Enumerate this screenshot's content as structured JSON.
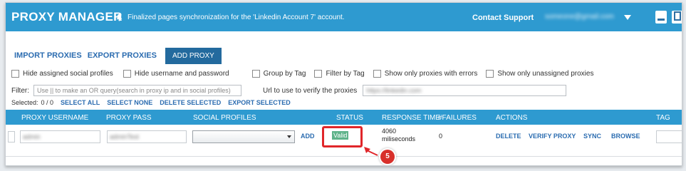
{
  "header": {
    "title": "PROXY MANAGER",
    "notification": "Finalized pages synchronization for the 'Linkedin Account 7' account.",
    "contact_support": "Contact Support",
    "user_email": "someone@gmail.com",
    "bell_icon": "bell-icon",
    "brand_color": "#2e9ad0"
  },
  "toolbar": {
    "import_label": "IMPORT PROXIES",
    "export_label": "EXPORT PROXIES",
    "add_label": "ADD PROXY"
  },
  "filters": {
    "options": [
      "Hide assigned social profiles",
      "Hide username and password",
      "Group by Tag",
      "Filter by Tag",
      "Show only proxies with errors",
      "Show only unassigned proxies"
    ],
    "filter_label": "Filter:",
    "filter_placeholder": "Use || to make an OR query(search in proxy ip and in social profiles)",
    "verify_url_label": "Url to use to verify the proxies",
    "verify_url_value": "https://linkedin.com"
  },
  "selection": {
    "selected_label": "Selected:",
    "selected_value": "0 / 0",
    "select_all": "SELECT ALL",
    "select_none": "SELECT NONE",
    "delete_selected": "DELETE SELECTED",
    "export_selected": "EXPORT SELECTED"
  },
  "table": {
    "headers": [
      "PROXY USERNAME",
      "PROXY PASS",
      "SOCIAL PROFILES",
      "STATUS",
      "RESPONSE TIME",
      "#FAILURES",
      "ACTIONS",
      "TAG"
    ],
    "row": {
      "username": "admin",
      "password": "adminTest",
      "add_label": "ADD",
      "status": "Valid",
      "response_time_value": "4060",
      "response_time_unit": "miliseconds",
      "failures": "0",
      "actions": [
        "DELETE",
        "VERIFY PROXY",
        "SYNC",
        "BROWSE"
      ]
    }
  },
  "annotation": {
    "step_number": "5",
    "highlight_color": "#e0262a"
  }
}
